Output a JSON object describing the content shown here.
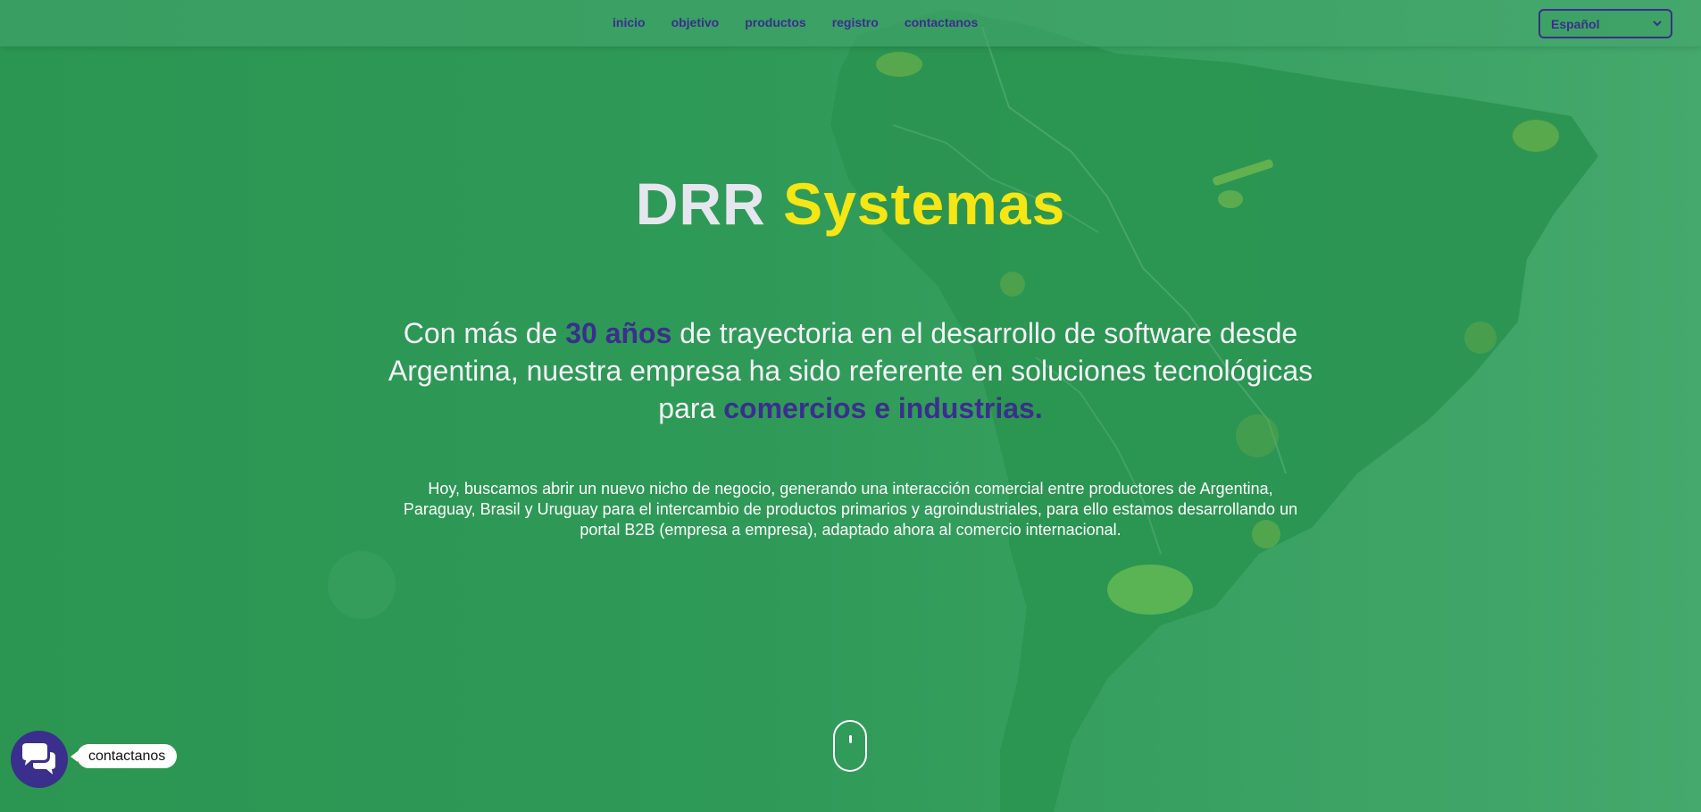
{
  "nav": {
    "items": [
      {
        "label": "inicio"
      },
      {
        "label": "objetivo"
      },
      {
        "label": "productos"
      },
      {
        "label": "registro"
      },
      {
        "label": "contactanos"
      }
    ],
    "language_selected": "Español"
  },
  "hero": {
    "title_part1": "DRR",
    "title_part2": "Systemas",
    "lead": {
      "t1": "Con más de ",
      "hl1": "30 años",
      "t2": " de trayectoria en el desarrollo de software desde Argentina, nuestra empresa ha sido referente en soluciones tecnológicas para ",
      "hl2": "comercios e industrias."
    },
    "body": "Hoy, buscamos abrir un nuevo nicho de negocio, generando una interacción comercial entre productores de Argentina, Paraguay, Brasil y Uruguay para el intercambio de productos primarios y agroindustriales, para ello estamos desarrollando un portal B2B (empresa a empresa), adaptado ahora al comercio internacional."
  },
  "chat": {
    "label": "contactanos",
    "icon": "chat-bubbles-icon"
  },
  "colors": {
    "background": "#2f9a57",
    "accent_purple": "#3a2f8c",
    "title_yellow": "#f5e614"
  }
}
